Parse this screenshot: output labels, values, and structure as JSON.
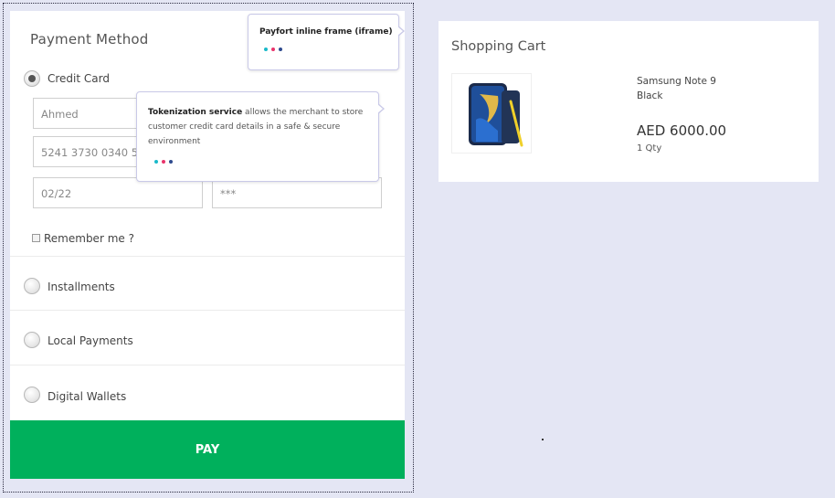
{
  "payment": {
    "title": "Payment Method",
    "methods": [
      {
        "label": "Credit Card",
        "selected": true
      },
      {
        "label": "Installments",
        "selected": false
      },
      {
        "label": "Local Payments",
        "selected": false
      },
      {
        "label": "Digital Wallets",
        "selected": false
      }
    ],
    "fields": {
      "name_value": "Ahmed",
      "card_number_value": "5241 3730 0340 5",
      "expiry_value": "02/22",
      "cvv_value": "***"
    },
    "remember_label": "Remember me ?",
    "pay_label": "PAY"
  },
  "tooltips": {
    "iframe": {
      "title": "Payfort inline frame (iframe)"
    },
    "tokenization": {
      "title": "Tokenization service",
      "text": " allows the merchant to store customer credit card details in a safe & secure environment"
    },
    "dot_colors": [
      "#19b9c9",
      "#e8336b",
      "#2e4a8e"
    ]
  },
  "cart": {
    "title": "Shopping Cart",
    "product": {
      "name": "Samsung Note 9",
      "color": "Black",
      "price": "AED 6000.00",
      "qty": "1 Qty"
    }
  },
  "colors": {
    "pay_button": "#00b05c",
    "background": "#e4e6f4"
  }
}
